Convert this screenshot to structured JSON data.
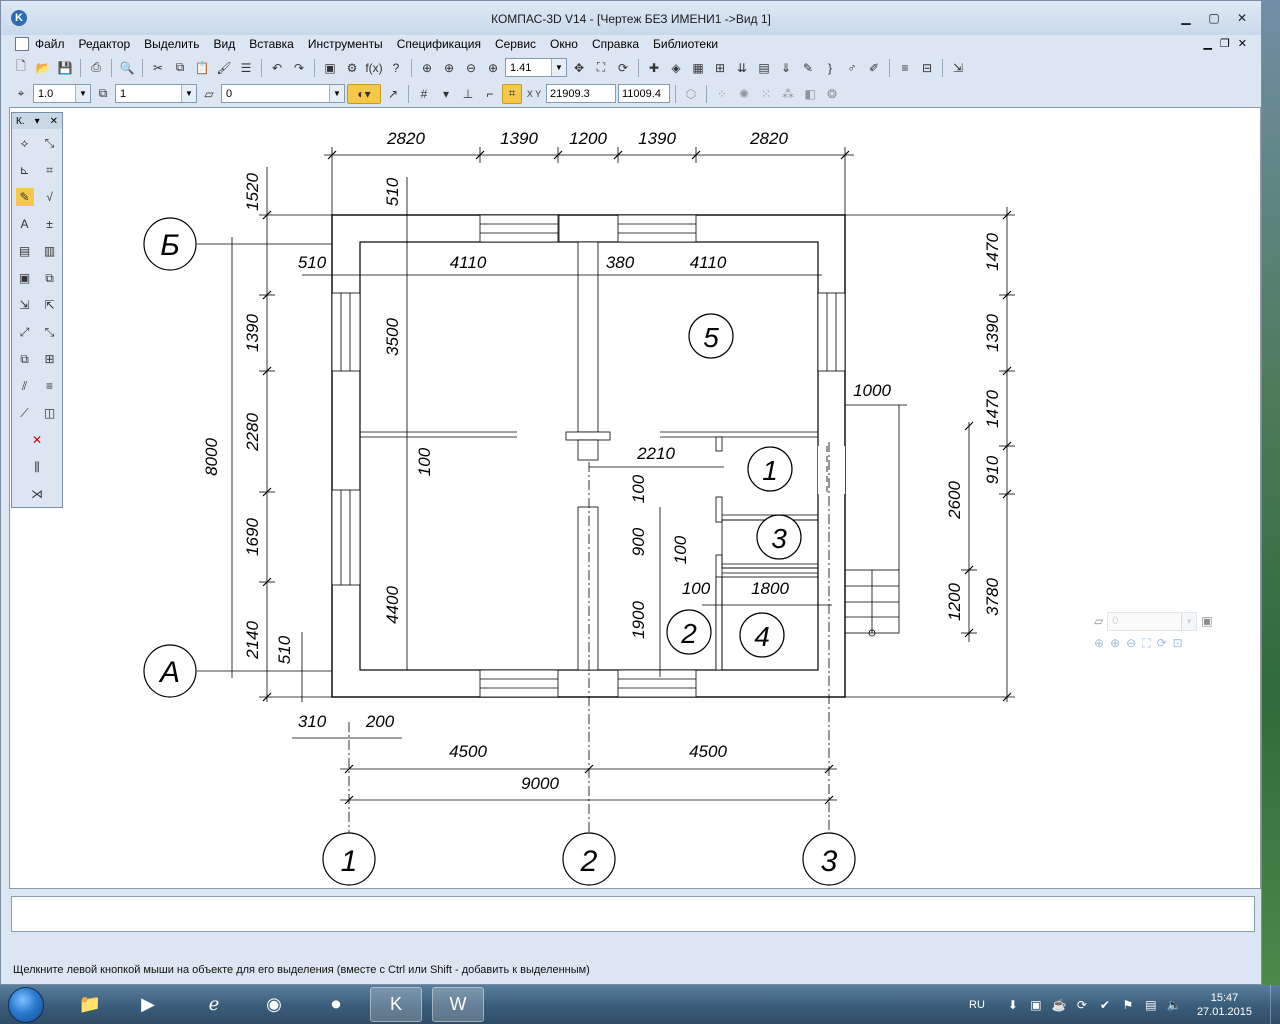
{
  "window": {
    "title": "КОМПАС-3D V14 - [Чертеж БЕЗ ИМЕНИ1 ->Вид 1]",
    "controls": [
      "minimize",
      "maximize",
      "close"
    ]
  },
  "menu": {
    "items": [
      "Файл",
      "Редактор",
      "Выделить",
      "Вид",
      "Вставка",
      "Инструменты",
      "Спецификация",
      "Сервис",
      "Окно",
      "Справка",
      "Библиотеки"
    ]
  },
  "toolbar_top": {
    "zoom_value": "1.41",
    "fx_label": "f(x)"
  },
  "toolbar_current": {
    "step_value": "1.0",
    "view_value": "1",
    "layer_value": "0",
    "coord_x": "21909.3",
    "coord_y": "11009.4",
    "xy_label": "X Y"
  },
  "palette": {
    "header": "К."
  },
  "float_panel": {
    "layer_value": "0"
  },
  "status": {
    "hint": "Щелкните левой кнопкой мыши на объекте для его выделения (вместе с Ctrl или Shift - добавить к выделенным)"
  },
  "drawing": {
    "axis_letters": [
      "Б",
      "А"
    ],
    "axis_numbers": [
      "1",
      "2",
      "3"
    ],
    "rooms": [
      "5",
      "1",
      "3",
      "2",
      "4"
    ],
    "dims_top": [
      "2820",
      "1390",
      "1200",
      "1390",
      "2820"
    ],
    "dims_inner_top": [
      "510",
      "4110",
      "380",
      "4110"
    ],
    "dims_left": [
      "1520",
      "1390",
      "2280",
      "1690",
      "2140"
    ],
    "dim_left_total": "8000",
    "dims_right": [
      "1470",
      "1390",
      "1470",
      "910",
      "3780"
    ],
    "dims_right_inner": [
      "2600",
      "1200"
    ],
    "dims_bottom": [
      "4500",
      "4500"
    ],
    "dim_bottom_total": "9000",
    "dims_misc": [
      "510",
      "3500",
      "100",
      "4400",
      "510",
      "310",
      "200",
      "2210",
      "1000",
      "100",
      "900",
      "100",
      "100",
      "1800",
      "1900"
    ]
  },
  "taskbar": {
    "lang": "RU",
    "time": "15:47",
    "date": "27.01.2015"
  }
}
